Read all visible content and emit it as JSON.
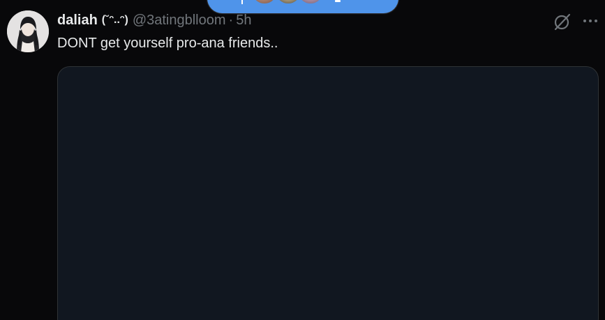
{
  "post": {
    "display_name": "daliah",
    "name_decoration": "(˘ᵔ..ᵔ)",
    "handle": "@3atingblloom",
    "separator": "·",
    "time": "5h",
    "text": "DONT get yourself pro-ana friends.."
  },
  "icons": {
    "grok": "grok-icon",
    "more": "more-options-icon",
    "arrow": "arrow-up-icon"
  },
  "colors": {
    "background": "#08080a",
    "pill": "#4f94ea",
    "text_primary": "#e7e9ea",
    "text_secondary": "#71767b",
    "media_background": "#111720"
  }
}
